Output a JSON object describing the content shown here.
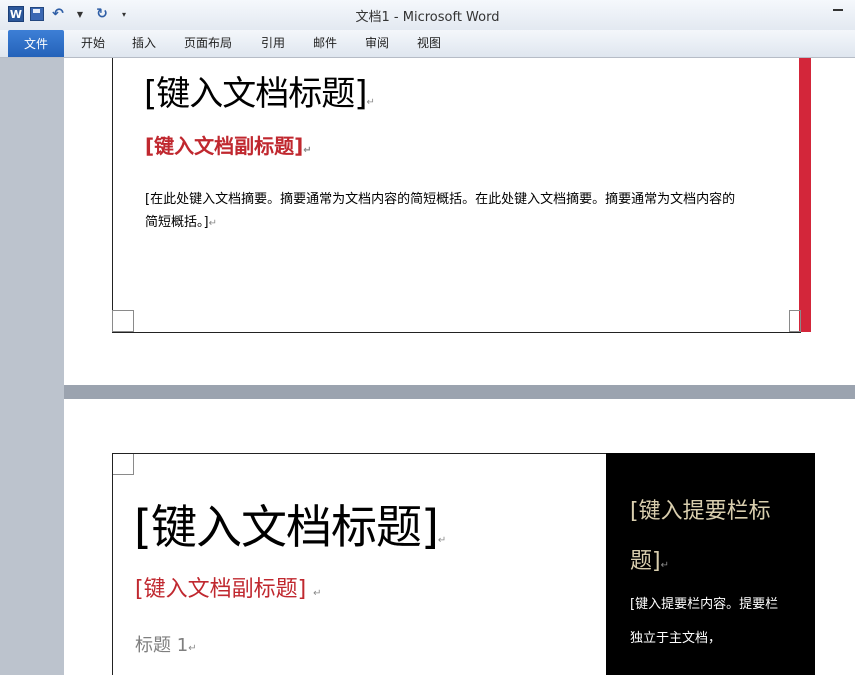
{
  "app": {
    "title": "文档1 - Microsoft Word"
  },
  "ribbon": {
    "file_tab": "文件",
    "tabs": [
      "开始",
      "插入",
      "页面布局",
      "引用",
      "邮件",
      "审阅",
      "视图"
    ]
  },
  "page1": {
    "title": "[键入文档标题]",
    "subtitle": "[键入文档副标题]",
    "abstract": "[在此处键入文档摘要。摘要通常为文档内容的简短概括。在此处键入文档摘要。摘要通常为文档内容的简短概括。]",
    "accent_color": "#d3263a"
  },
  "page2": {
    "title": "[键入文档标题]",
    "subtitle": "[键入文档副标题]",
    "heading": "标题 1",
    "sidebar_title": "[键入提要栏标题]",
    "sidebar_text": "[键入提要栏内容。提要栏独立于主文档，"
  },
  "icons": {
    "paragraph_mark": "↵"
  }
}
